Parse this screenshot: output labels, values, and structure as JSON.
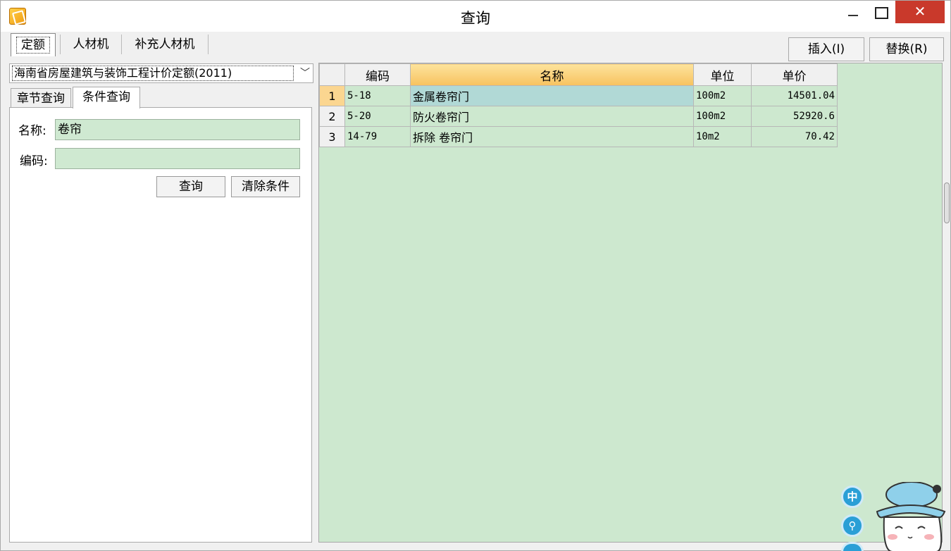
{
  "window": {
    "title": "查询",
    "close_glyph": "✕"
  },
  "top_tabs": [
    "定额",
    "人材机",
    "补充人材机"
  ],
  "buttons": {
    "insert": "插入(I)",
    "replace": "替换(R)"
  },
  "quota_library": "海南省房屋建筑与装饰工程计价定额(2011)",
  "sub_tabs": [
    "章节查询",
    "条件查询"
  ],
  "search": {
    "name_label": "名称:",
    "name_value": "卷帘",
    "code_label": "编码:",
    "code_value": "",
    "query_button": "查询",
    "clear_button": "清除条件"
  },
  "grid": {
    "columns": [
      "编码",
      "名称",
      "单位",
      "单价"
    ],
    "rows": [
      {
        "no": "1",
        "code": "5-18",
        "name": "金属卷帘门",
        "unit": "100m2",
        "price": "14501.04"
      },
      {
        "no": "2",
        "code": "5-20",
        "name": "防火卷帘门",
        "unit": "100m2",
        "price": "52920.6"
      },
      {
        "no": "3",
        "code": "14-79",
        "name": "拆除 卷帘门",
        "unit": "10m2",
        "price": "70.42"
      }
    ]
  },
  "ime": {
    "lang": "中",
    "mic": "⚲"
  },
  "colors": {
    "grid_bg": "#cde8cf",
    "selected_cell": "#b1d9d6",
    "sorted_header": "#f7c25f",
    "close_red": "#c9392b"
  }
}
